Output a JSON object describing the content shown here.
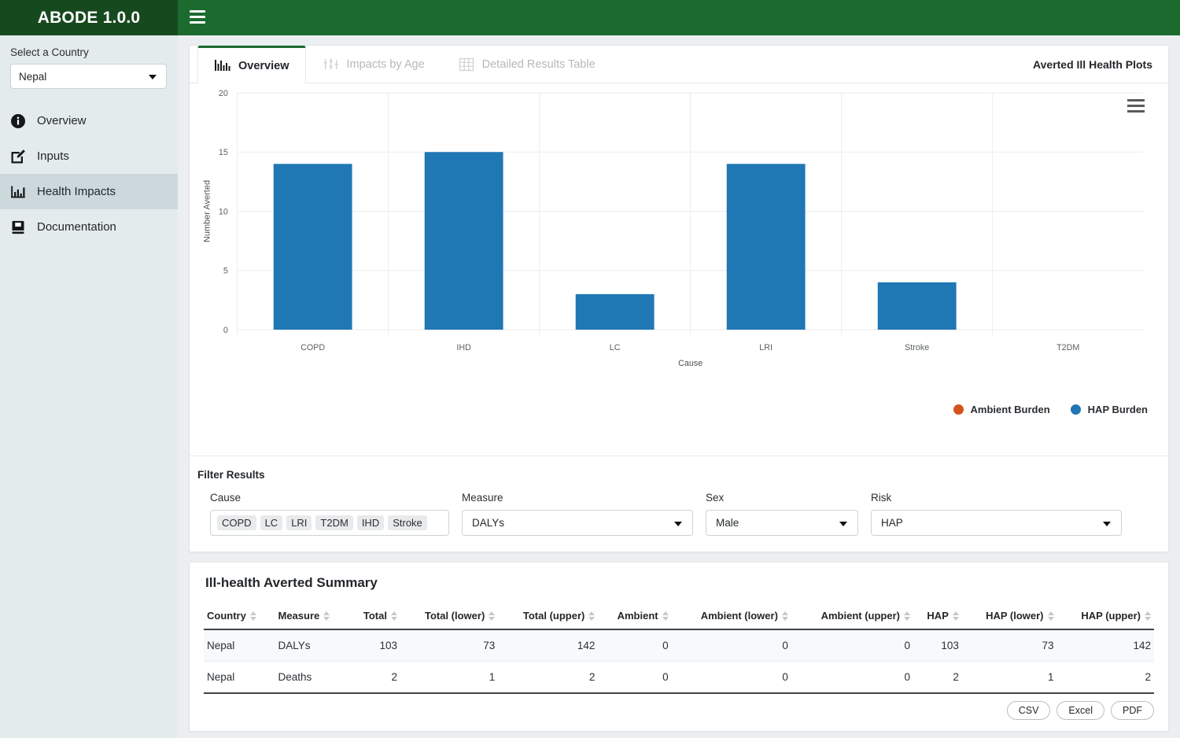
{
  "brand": {
    "title": "ABODE 1.0.0"
  },
  "sidebar": {
    "country_label": "Select a Country",
    "country_value": "Nepal",
    "items": [
      {
        "label": "Overview",
        "icon": "info-circle-icon"
      },
      {
        "label": "Inputs",
        "icon": "pencil-square-icon"
      },
      {
        "label": "Health Impacts",
        "icon": "bar-chart-icon"
      },
      {
        "label": "Documentation",
        "icon": "book-icon"
      }
    ]
  },
  "tabs": [
    {
      "label": "Overview",
      "icon": "bar-chart-icon",
      "active": true
    },
    {
      "label": "Impacts by Age",
      "icon": "strip-plot-icon",
      "active": false
    },
    {
      "label": "Detailed Results Table",
      "icon": "table-grid-icon",
      "active": false
    }
  ],
  "plots_title": "Averted Ill Health Plots",
  "chart_data": {
    "type": "bar",
    "title": "",
    "categories": [
      "COPD",
      "IHD",
      "LC",
      "LRI",
      "Stroke",
      "T2DM"
    ],
    "series": [
      {
        "name": "HAP Burden",
        "color": "#1f77b4",
        "values": [
          14,
          15,
          3,
          14,
          4,
          0
        ]
      }
    ],
    "legend": [
      {
        "label": "Ambient Burden",
        "color": "#d4521e"
      },
      {
        "label": "HAP Burden",
        "color": "#1f77b4"
      }
    ],
    "xlabel": "Cause",
    "ylabel": "Number Averted",
    "yticks": [
      0,
      5,
      10,
      15,
      20
    ],
    "ylim": [
      0,
      20
    ],
    "grid": true,
    "legend_position": "bottom-right"
  },
  "filters": {
    "title": "Filter Results",
    "cause": {
      "label": "Cause",
      "chips": [
        "COPD",
        "LC",
        "LRI",
        "T2DM",
        "IHD",
        "Stroke"
      ]
    },
    "measure": {
      "label": "Measure",
      "value": "DALYs"
    },
    "sex": {
      "label": "Sex",
      "value": "Male"
    },
    "risk": {
      "label": "Risk",
      "value": "HAP"
    }
  },
  "summary": {
    "title": "Ill-health Averted Summary",
    "columns": [
      "Country",
      "Measure",
      "Total",
      "Total (lower)",
      "Total (upper)",
      "Ambient",
      "Ambient (lower)",
      "Ambient (upper)",
      "HAP",
      "HAP (lower)",
      "HAP (upper)"
    ],
    "rows": [
      {
        "country": "Nepal",
        "measure": "DALYs",
        "total": "103",
        "total_lower": "73",
        "total_upper": "142",
        "ambient": "0",
        "ambient_lower": "0",
        "ambient_upper": "0",
        "hap": "103",
        "hap_lower": "73",
        "hap_upper": "142"
      },
      {
        "country": "Nepal",
        "measure": "Deaths",
        "total": "2",
        "total_lower": "1",
        "total_upper": "2",
        "ambient": "0",
        "ambient_lower": "0",
        "ambient_upper": "0",
        "hap": "2",
        "hap_lower": "1",
        "hap_upper": "2"
      }
    ],
    "exports": [
      "CSV",
      "Excel",
      "PDF"
    ]
  },
  "colors": {
    "brand_dark_green": "#17491f",
    "topbar_green": "#1b6b2f",
    "bar_blue": "#1f77b4",
    "ambient_orange": "#d4521e",
    "sidebar_bg": "#e4ebec",
    "sidebar_active": "#ccd8dc"
  }
}
